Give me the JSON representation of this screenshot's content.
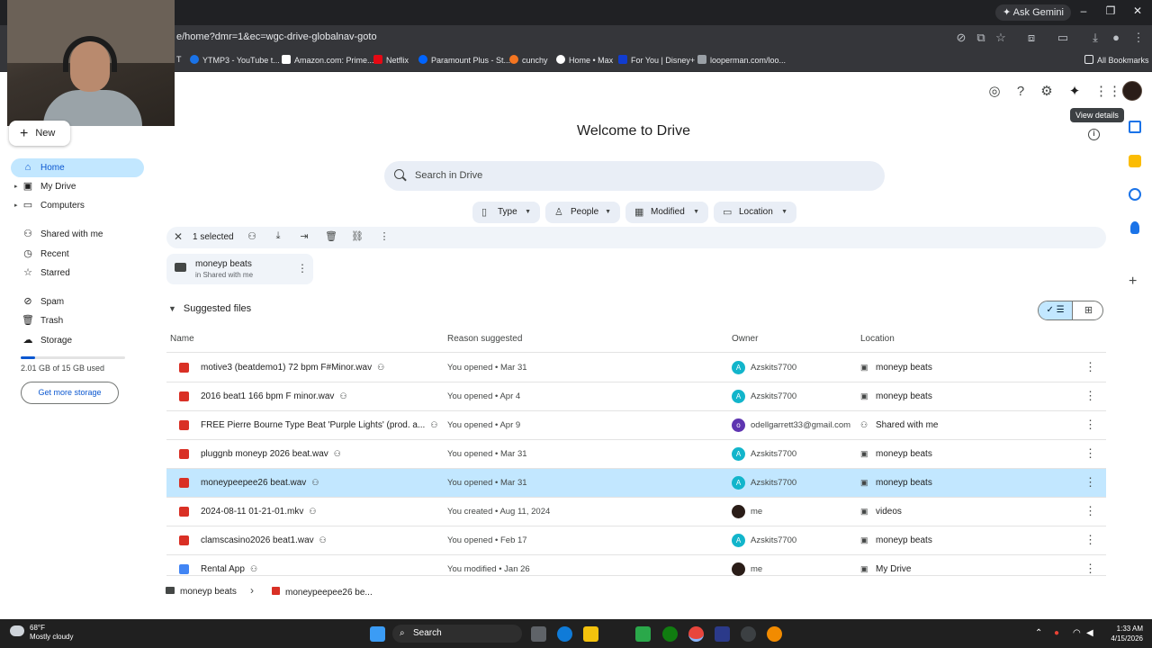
{
  "browser": {
    "ask_gemini": "Ask Gemini",
    "url": "e/home?dmr=1&ec=wgc-drive-globalnav-goto",
    "bookmarks": [
      "YTMP3 - YouTube t...",
      "Amazon.com: Prime...",
      "Netflix",
      "Paramount Plus - St...",
      "cunchy",
      "Home • Max",
      "For You | Disney+",
      "looperman.com/loo..."
    ],
    "bookmark_first_fragment": "T",
    "all_bookmarks": "All Bookmarks"
  },
  "drive": {
    "tooltip": "View details",
    "new_label": "New",
    "nav": {
      "home": "Home",
      "my_drive": "My Drive",
      "computers": "Computers",
      "shared": "Shared with me",
      "recent": "Recent",
      "starred": "Starred",
      "spam": "Spam",
      "trash": "Trash",
      "storage": "Storage"
    },
    "storage_used_text": "2.01 GB of 15 GB used",
    "storage_fraction": 0.134,
    "get_storage": "Get more storage",
    "welcome": "Welcome to Drive",
    "search_placeholder": "Search in Drive",
    "filters": {
      "type": "Type",
      "people": "People",
      "modified": "Modified",
      "location": "Location"
    },
    "selection": "1 selected",
    "folder_card": {
      "name": "moneyp beats",
      "sub": "in Shared with me"
    },
    "suggested_title": "Suggested files",
    "columns": {
      "name": "Name",
      "reason": "Reason suggested",
      "owner": "Owner",
      "location": "Location"
    },
    "files": [
      {
        "name": "motive3 (beatdemo1) 72 bpm F#Minor.wav",
        "reason": "You opened • Mar 31",
        "owner_initial": "A",
        "owner": "Azskits7700",
        "location": "moneyp beats"
      },
      {
        "name": "2016 beat1 166 bpm F minor.wav",
        "reason": "You opened • Apr 4",
        "owner_initial": "A",
        "owner": "Azskits7700",
        "location": "moneyp beats"
      },
      {
        "name": "FREE Pierre Bourne Type Beat 'Purple Lights' (prod. a...",
        "reason": "You opened • Apr 9",
        "owner_initial": "o",
        "owner": "odellgarrett33@gmail.com",
        "location": "Shared with me"
      },
      {
        "name": "pluggnb moneyp 2026 beat.wav",
        "reason": "You opened • Mar 31",
        "owner_initial": "A",
        "owner": "Azskits7700",
        "location": "moneyp beats"
      },
      {
        "name": "moneypeepee26 beat.wav",
        "reason": "You opened • Mar 31",
        "owner_initial": "A",
        "owner": "Azskits7700",
        "location": "moneyp beats"
      },
      {
        "name": "2024-08-11 01-21-01.mkv",
        "reason": "You created • Aug 11, 2024",
        "owner_initial": "",
        "owner": "me",
        "location": "videos"
      },
      {
        "name": "clamscasino2026 beat1.wav",
        "reason": "You opened • Feb 17",
        "owner_initial": "A",
        "owner": "Azskits7700",
        "location": "moneyp beats"
      },
      {
        "name": "Rental App",
        "reason": "You modified • Jan 26",
        "owner_initial": "",
        "owner": "me",
        "location": "My Drive"
      }
    ],
    "breadcrumb": {
      "folder": "moneyp beats",
      "file": "moneypeepee26 be..."
    }
  },
  "taskbar": {
    "temp": "68°F",
    "weather": "Mostly cloudy",
    "search": "Search",
    "time": "1:33 AM",
    "date": "4/15/2026"
  },
  "colors": {
    "accent": "#0b57d0",
    "selection": "#c2e7ff",
    "audio_icon": "#d93025",
    "owner_teal": "#12b5cb",
    "owner_purple": "#5e35b1"
  }
}
